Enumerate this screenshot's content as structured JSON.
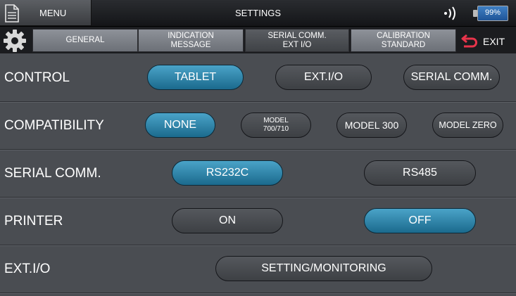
{
  "topbar": {
    "menu_label": "MENU",
    "title": "SETTINGS",
    "battery_percent": "99%"
  },
  "tabs": [
    {
      "label": "GENERAL",
      "active": false
    },
    {
      "label": "INDICATION\nMESSAGE",
      "active": false
    },
    {
      "label": "SERIAL COMM.\nEXT I/O",
      "active": true
    },
    {
      "label": "CALIBRATION\nSTANDARD",
      "active": false
    }
  ],
  "exit_label": "EXIT",
  "rows": {
    "control": {
      "label": "CONTROL",
      "options": [
        "TABLET",
        "EXT.I/O",
        "SERIAL COMM."
      ],
      "selected": "TABLET"
    },
    "compatibility": {
      "label": "COMPATIBILITY",
      "options": [
        "NONE",
        "MODEL",
        "700/710",
        "MODEL 300",
        "MODEL ZERO"
      ],
      "selected": "NONE"
    },
    "serial_comm": {
      "label": "SERIAL COMM.",
      "options": [
        "RS232C",
        "RS485"
      ],
      "selected": "RS232C"
    },
    "printer": {
      "label": "PRINTER",
      "options": [
        "ON",
        "OFF"
      ],
      "selected": "OFF"
    },
    "ext_io": {
      "label": "EXT.I/O",
      "button": "SETTING/MONITORING"
    }
  },
  "colors": {
    "background": "#4a4d52",
    "selected_pill": "#2a84aa",
    "tab": "#7d8188",
    "exit_arrow": "#e8344b",
    "battery": "#2f6bb0"
  }
}
